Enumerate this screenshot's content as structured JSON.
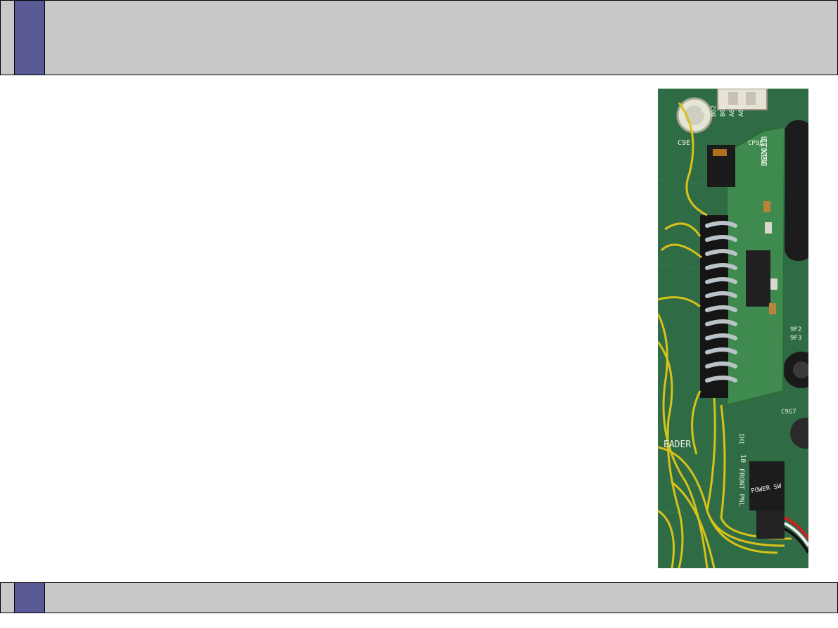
{
  "slide": {
    "header": {
      "title": ""
    },
    "footer": {
      "text": ""
    }
  },
  "photo": {
    "subject": "motherboard-header-with-soldered-module",
    "silkscreen": {
      "c9e": "C9E",
      "plus": "+",
      "b62": "B62",
      "b61": "B61",
      "a62": "A62",
      "a61": "A61",
      "cp": "CP9E",
      "maxim": "maxim",
      "chip_code": "DS2032",
      "f2": "9F2",
      "f3": "9F3",
      "c9g7": "C9G7",
      "header": "EADER",
      "ihi": "IHI",
      "front_pnl": "FRONT PNL",
      "ten": "10",
      "power_sw": "POWER SW"
    },
    "colors": {
      "board": "#2f6b45",
      "wire": "#d8c21a",
      "module": "#3f8a4e",
      "header_black": "#151515",
      "solder": "#b9c3c8"
    }
  }
}
